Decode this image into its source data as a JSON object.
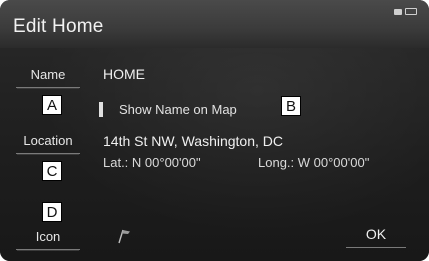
{
  "header": {
    "title": "Edit Home",
    "status_icons": [
      "signal-icon",
      "battery-icon"
    ]
  },
  "fields": {
    "name_label": "Name",
    "name_value": "HOME",
    "show_name_label": "Show Name on Map",
    "location_label": "Location",
    "address": "14th St NW, Washington, DC",
    "latitude": "Lat.: N 00°00'00\"",
    "longitude": "Long.: W 00°00'00\"",
    "icon_label": "Icon",
    "icon_preview": "flag-icon"
  },
  "callouts": {
    "a": "A",
    "b": "B",
    "c": "C",
    "d": "D"
  },
  "footer": {
    "ok_label": "OK"
  }
}
